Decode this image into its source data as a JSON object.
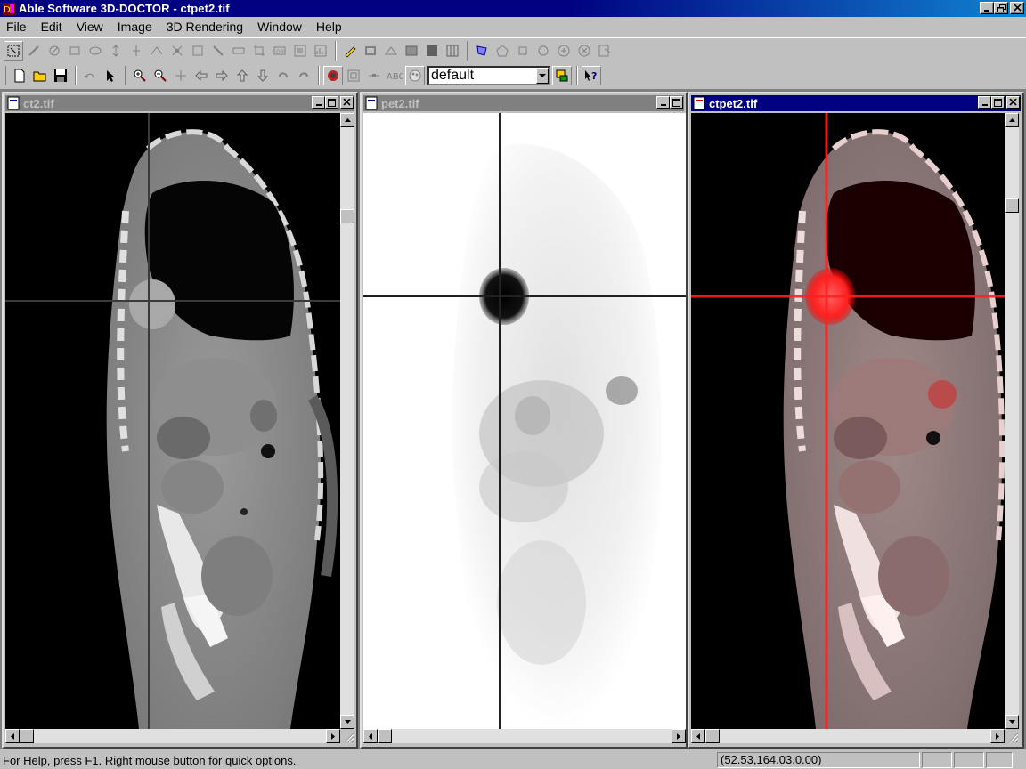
{
  "window": {
    "title": "Able Software 3D-DOCTOR - ctpet2.tif"
  },
  "menu": [
    "File",
    "Edit",
    "View",
    "Image",
    "3D Rendering",
    "Window",
    "Help"
  ],
  "toolbar": {
    "preset_value": "default"
  },
  "children": [
    {
      "title": "ct2.tif",
      "active": false
    },
    {
      "title": "pet2.tif",
      "active": false
    },
    {
      "title": "ctpet2.tif",
      "active": true
    }
  ],
  "status": {
    "help_text": "For Help, press F1. Right mouse button for quick options.",
    "coords": "(52.53,164.03,0.00)"
  },
  "colors": {
    "title_active": "#000080",
    "title_inactive": "#808080",
    "crosshair_ct": "#3a3a3a",
    "crosshair_pet": "#202020",
    "crosshair_fused": "#ff2020"
  }
}
